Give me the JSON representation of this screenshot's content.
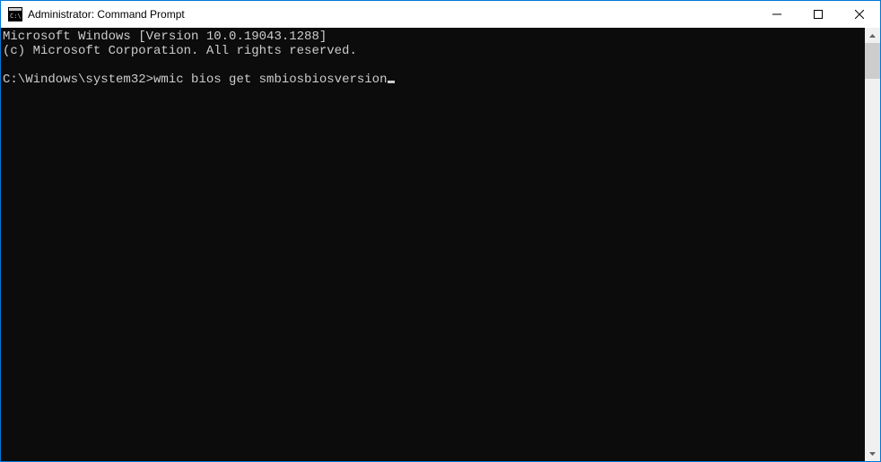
{
  "window": {
    "title": "Administrator: Command Prompt"
  },
  "console": {
    "line1": "Microsoft Windows [Version 10.0.19043.1288]",
    "line2": "(c) Microsoft Corporation. All rights reserved.",
    "blank": "",
    "prompt": "C:\\Windows\\system32>",
    "command": "wmic bios get smbiosbiosversion"
  }
}
